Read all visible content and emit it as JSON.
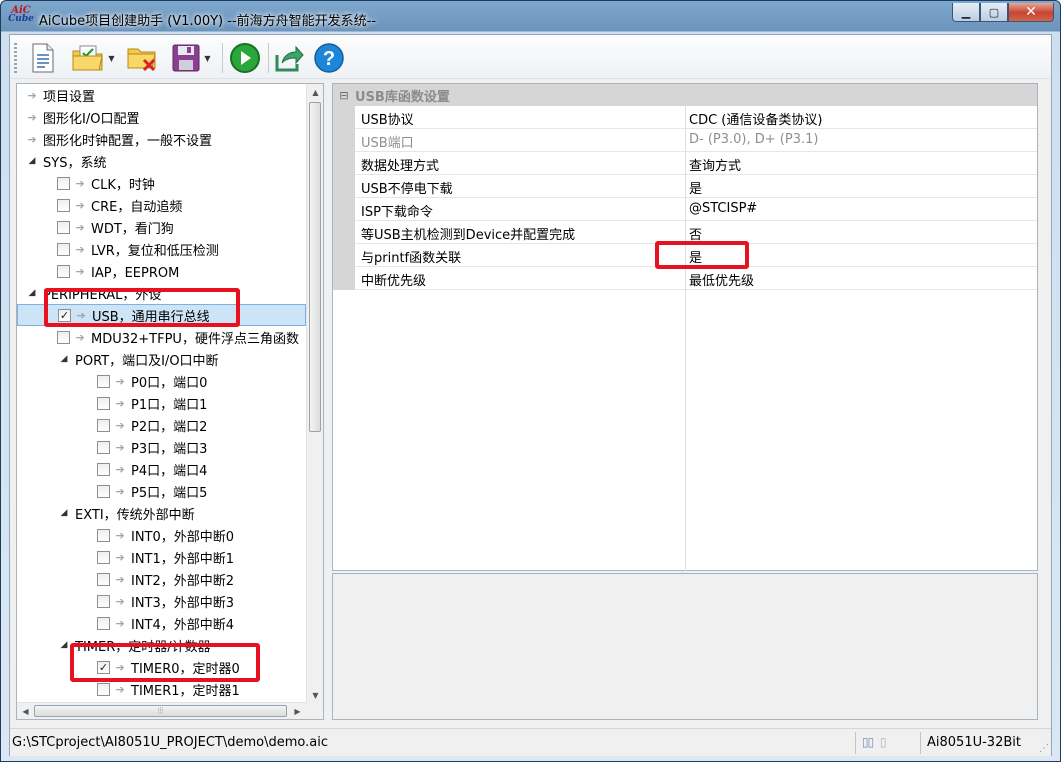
{
  "window": {
    "title": "AiCube项目创建助手 (V1.00Y) --前海方舟智能开发系统--",
    "logo_top": "AiC",
    "logo_bottom": "Cube",
    "close_glyph": "✕",
    "min_glyph": "▁",
    "max_glyph": "▢"
  },
  "toolbar": {
    "items": [
      {
        "icon": "new-document-icon"
      },
      {
        "icon": "open-folder-icon",
        "dropdown": true
      },
      {
        "icon": "close-project-icon"
      },
      {
        "icon": "save-icon",
        "dropdown": true
      },
      {
        "icon": "run-icon"
      },
      {
        "icon": "export-icon"
      },
      {
        "icon": "help-icon",
        "label": "?"
      }
    ]
  },
  "tree": {
    "rows": [
      {
        "level": 0,
        "marker": "arrow",
        "label": "项目设置"
      },
      {
        "level": 0,
        "marker": "arrow",
        "label": "图形化I/O口配置"
      },
      {
        "level": 0,
        "marker": "arrow",
        "label": "图形化时钟配置，一般不设置"
      },
      {
        "level": 0,
        "marker": "expanded",
        "label": "SYS，系统"
      },
      {
        "level": 1,
        "marker": "checkbox",
        "checked": false,
        "label": "CLK，时钟"
      },
      {
        "level": 1,
        "marker": "checkbox",
        "checked": false,
        "label": "CRE，自动追频"
      },
      {
        "level": 1,
        "marker": "checkbox",
        "checked": false,
        "label": "WDT，看门狗"
      },
      {
        "level": 1,
        "marker": "checkbox",
        "checked": false,
        "label": "LVR，复位和低压检测"
      },
      {
        "level": 1,
        "marker": "checkbox",
        "checked": false,
        "label": "IAP，EEPROM"
      },
      {
        "level": 0,
        "marker": "expanded",
        "label": "PERIPHERAL，外设"
      },
      {
        "level": 1,
        "marker": "checkbox",
        "checked": true,
        "selected": true,
        "label": "USB，通用串行总线"
      },
      {
        "level": 1,
        "marker": "checkbox",
        "checked": false,
        "label": "MDU32+TFPU，硬件浮点三角函数"
      },
      {
        "level": 1,
        "marker": "expanded",
        "label": "PORT，端口及I/O口中断"
      },
      {
        "level": 2,
        "marker": "checkbox",
        "checked": false,
        "label": "P0口，端口0"
      },
      {
        "level": 2,
        "marker": "checkbox",
        "checked": false,
        "label": "P1口，端口1"
      },
      {
        "level": 2,
        "marker": "checkbox",
        "checked": false,
        "label": "P2口，端口2"
      },
      {
        "level": 2,
        "marker": "checkbox",
        "checked": false,
        "label": "P3口，端口3"
      },
      {
        "level": 2,
        "marker": "checkbox",
        "checked": false,
        "label": "P4口，端口4"
      },
      {
        "level": 2,
        "marker": "checkbox",
        "checked": false,
        "label": "P5口，端口5"
      },
      {
        "level": 1,
        "marker": "expanded",
        "label": "EXTI，传统外部中断"
      },
      {
        "level": 2,
        "marker": "checkbox",
        "checked": false,
        "label": "INT0，外部中断0"
      },
      {
        "level": 2,
        "marker": "checkbox",
        "checked": false,
        "label": "INT1，外部中断1"
      },
      {
        "level": 2,
        "marker": "checkbox",
        "checked": false,
        "label": "INT2，外部中断2"
      },
      {
        "level": 2,
        "marker": "checkbox",
        "checked": false,
        "label": "INT3，外部中断3"
      },
      {
        "level": 2,
        "marker": "checkbox",
        "checked": false,
        "label": "INT4，外部中断4"
      },
      {
        "level": 1,
        "marker": "expanded",
        "label": "TIMER，定时器/计数器"
      },
      {
        "level": 2,
        "marker": "checkbox",
        "checked": true,
        "label": "TIMER0，定时器0"
      },
      {
        "level": 2,
        "marker": "checkbox",
        "checked": false,
        "label": "TIMER1，定时器1"
      }
    ],
    "hscroll_grip": "⦙⦙⦙"
  },
  "properties": {
    "category": "USB库函数设置",
    "collapse_glyph": "⊟",
    "rows": [
      {
        "name": "USB协议",
        "value": "CDC (通信设备类协议)",
        "disabled": false
      },
      {
        "name": "USB端口",
        "value": "D- (P3.0), D+ (P3.1)",
        "disabled": true
      },
      {
        "name": "数据处理方式",
        "value": "查询方式",
        "disabled": false
      },
      {
        "name": "USB不停电下载",
        "value": "是",
        "disabled": false
      },
      {
        "name": "ISP下载命令",
        "value": "@STCISP#",
        "disabled": false
      },
      {
        "name": "等USB主机检测到Device并配置完成",
        "value": "否",
        "disabled": false
      },
      {
        "name": "与printf函数关联",
        "value": "是",
        "disabled": false
      },
      {
        "name": "中断优先级",
        "value": "最低优先级",
        "disabled": false
      }
    ]
  },
  "statusbar": {
    "path": "G:\\STCproject\\AI8051U_PROJECT\\demo\\demo.aic",
    "model": "Ai8051U-32Bit",
    "chip1": "▯▯",
    "chip2": "▯"
  },
  "colors": {
    "highlight": "#e8111f",
    "selection": "#cde4f7"
  }
}
